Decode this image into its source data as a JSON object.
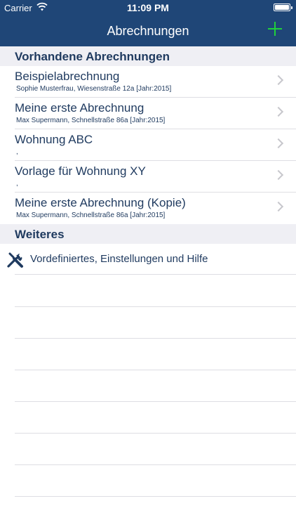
{
  "status_bar": {
    "carrier": "Carrier",
    "time": "11:09 PM"
  },
  "nav": {
    "title": "Abrechnungen",
    "add_icon": "plus-icon"
  },
  "sections": {
    "existing": "Vorhandene Abrechnungen",
    "more": "Weiteres"
  },
  "rows": [
    {
      "title": "Beispielabrechnung",
      "subtitle": "Sophie Musterfrau, Wiesenstraße 12a [Jahr:2015]"
    },
    {
      "title": "Meine erste Abrechnung",
      "subtitle": "Max Supermann, Schnellstraße 86a [Jahr:2015]"
    },
    {
      "title": "Wohnung ABC",
      "subtitle": ","
    },
    {
      "title": "Vorlage für Wohnung XY",
      "subtitle": ","
    },
    {
      "title": "Meine erste Abrechnung (Kopie)",
      "subtitle": "Max Supermann, Schnellstraße 86a [Jahr:2015]"
    }
  ],
  "more_item": {
    "label": "Vordefiniertes, Einstellungen und Hilfe",
    "icon": "tools-icon"
  },
  "colors": {
    "nav_bg": "#1f4677",
    "accent_green": "#1fd13b",
    "text": "#1f3a5f",
    "section_bg": "#efeff4"
  }
}
